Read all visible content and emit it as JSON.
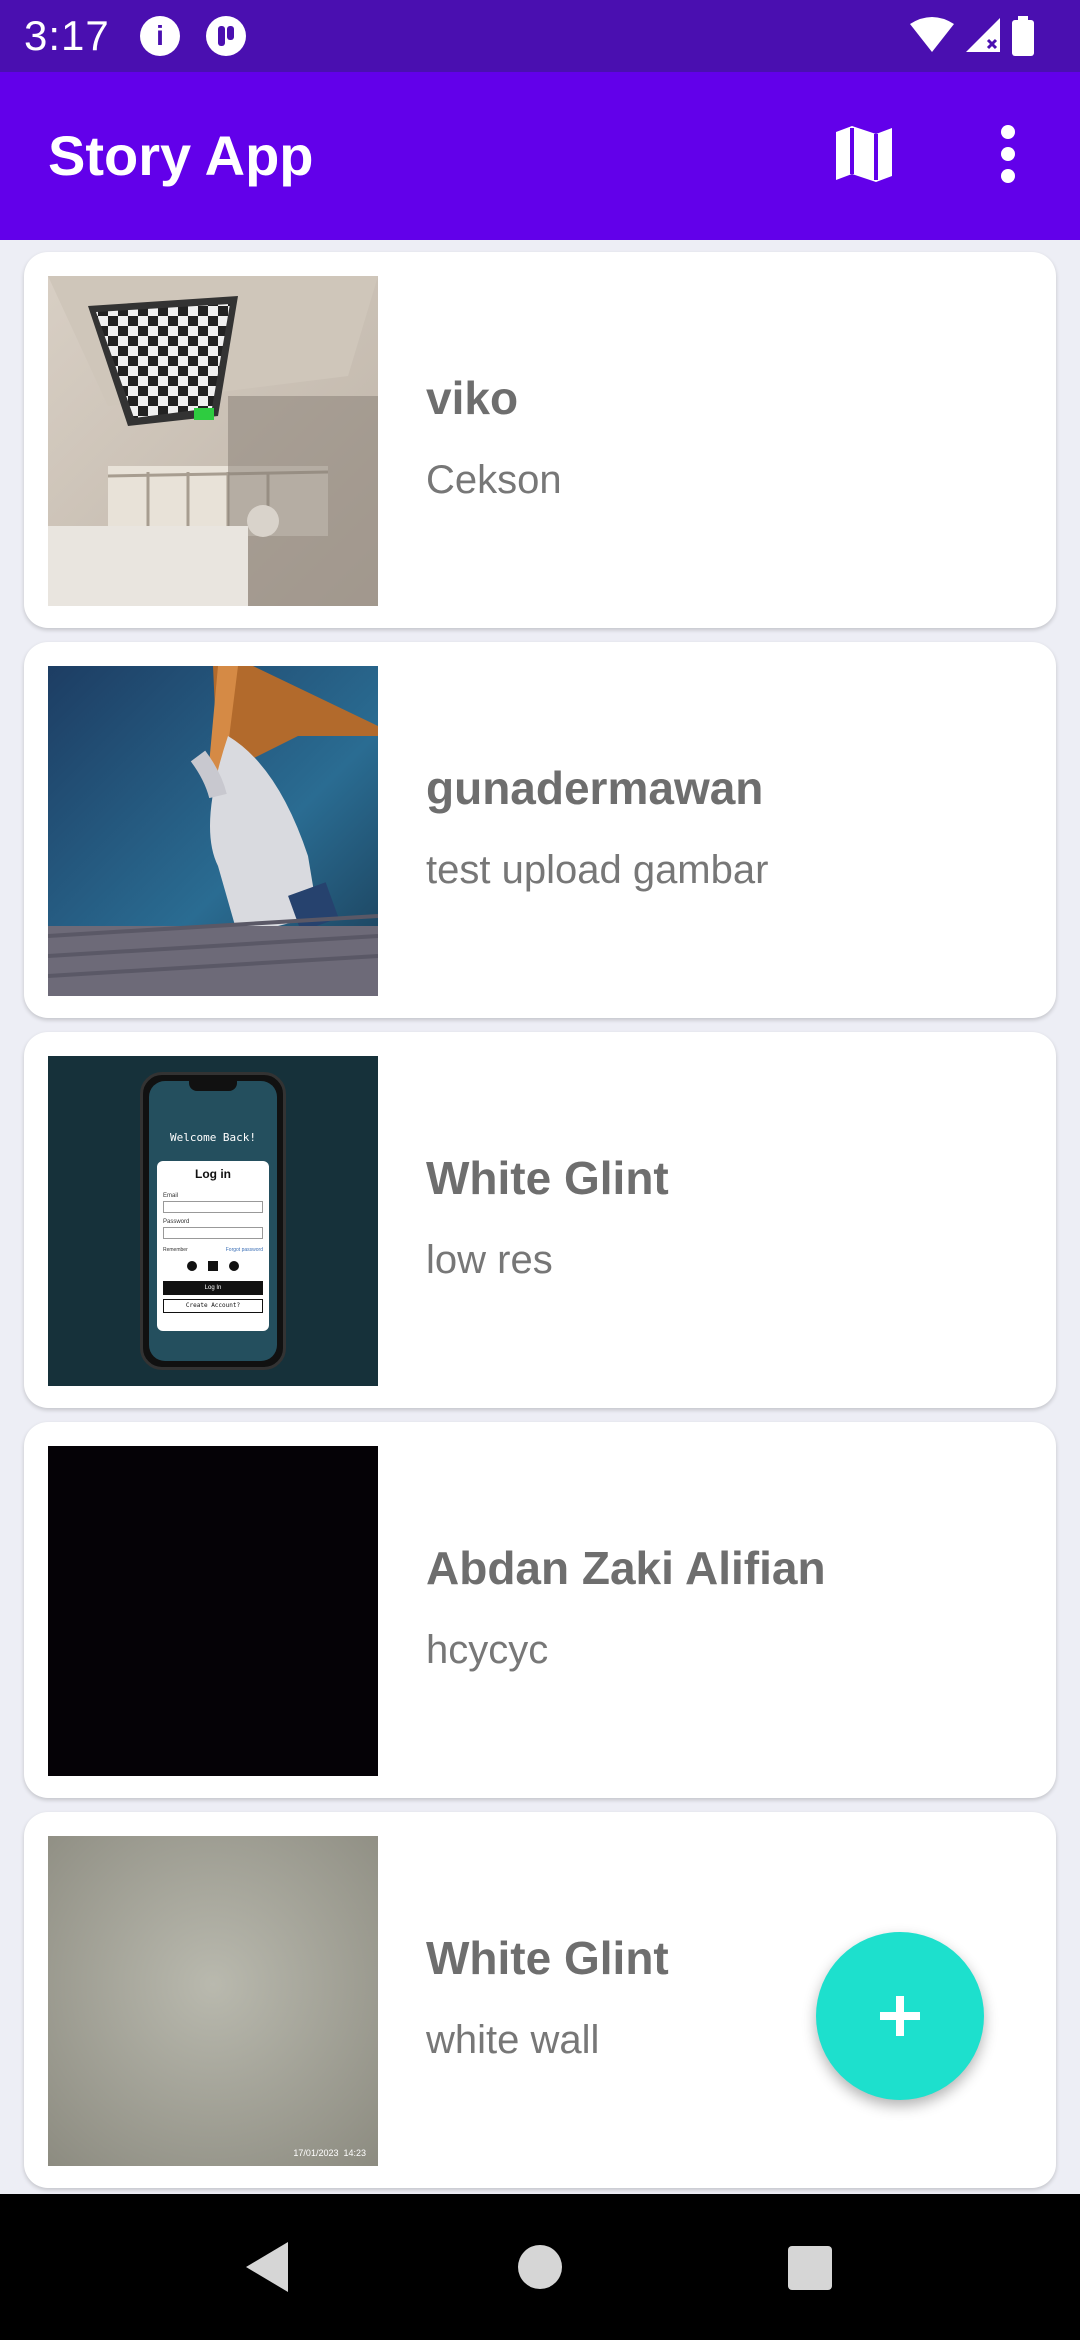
{
  "status_bar": {
    "time": "3:17",
    "left_icons": [
      "info-icon",
      "app-notification-icon"
    ],
    "right_icons": [
      "wifi-icon",
      "signal-icon",
      "battery-icon"
    ]
  },
  "app_bar": {
    "title": "Story App",
    "actions": [
      "map-icon",
      "more-vert-icon"
    ]
  },
  "stories": [
    {
      "name": "viko",
      "description": "Cekson",
      "thumbnail": "ceiling-checkerboard-photo"
    },
    {
      "name": "gunadermawan",
      "description": "test upload gambar",
      "thumbnail": "hand-on-wood-photo"
    },
    {
      "name": "White Glint",
      "description": "low res",
      "thumbnail": "phone-login-screen-photo"
    },
    {
      "name": "Abdan Zaki Alifian",
      "description": "hcycyc",
      "thumbnail": "black-photo"
    },
    {
      "name": "White Glint",
      "description": "white wall",
      "thumbnail": "white-wall-photo",
      "timestamp_overlay": "17/01/2023  14:23"
    }
  ],
  "phone_mockup": {
    "header": "Welcome Back!",
    "title": "Log in",
    "email_label": "Email",
    "password_label": "Password",
    "remember_label": "Remember",
    "forgot_label": "Forgot password",
    "login_button": "Log In",
    "create_button": "Create Account?"
  },
  "fab": {
    "icon": "add-icon"
  },
  "nav_bar": {
    "buttons": [
      "back-icon",
      "home-icon",
      "recents-icon"
    ]
  },
  "colors": {
    "status_bar": "#4A0FB0",
    "app_bar": "#6200EA",
    "background": "#EDEEF5",
    "fab": "#1DE0CD",
    "name_text": "#6E6E6E"
  }
}
